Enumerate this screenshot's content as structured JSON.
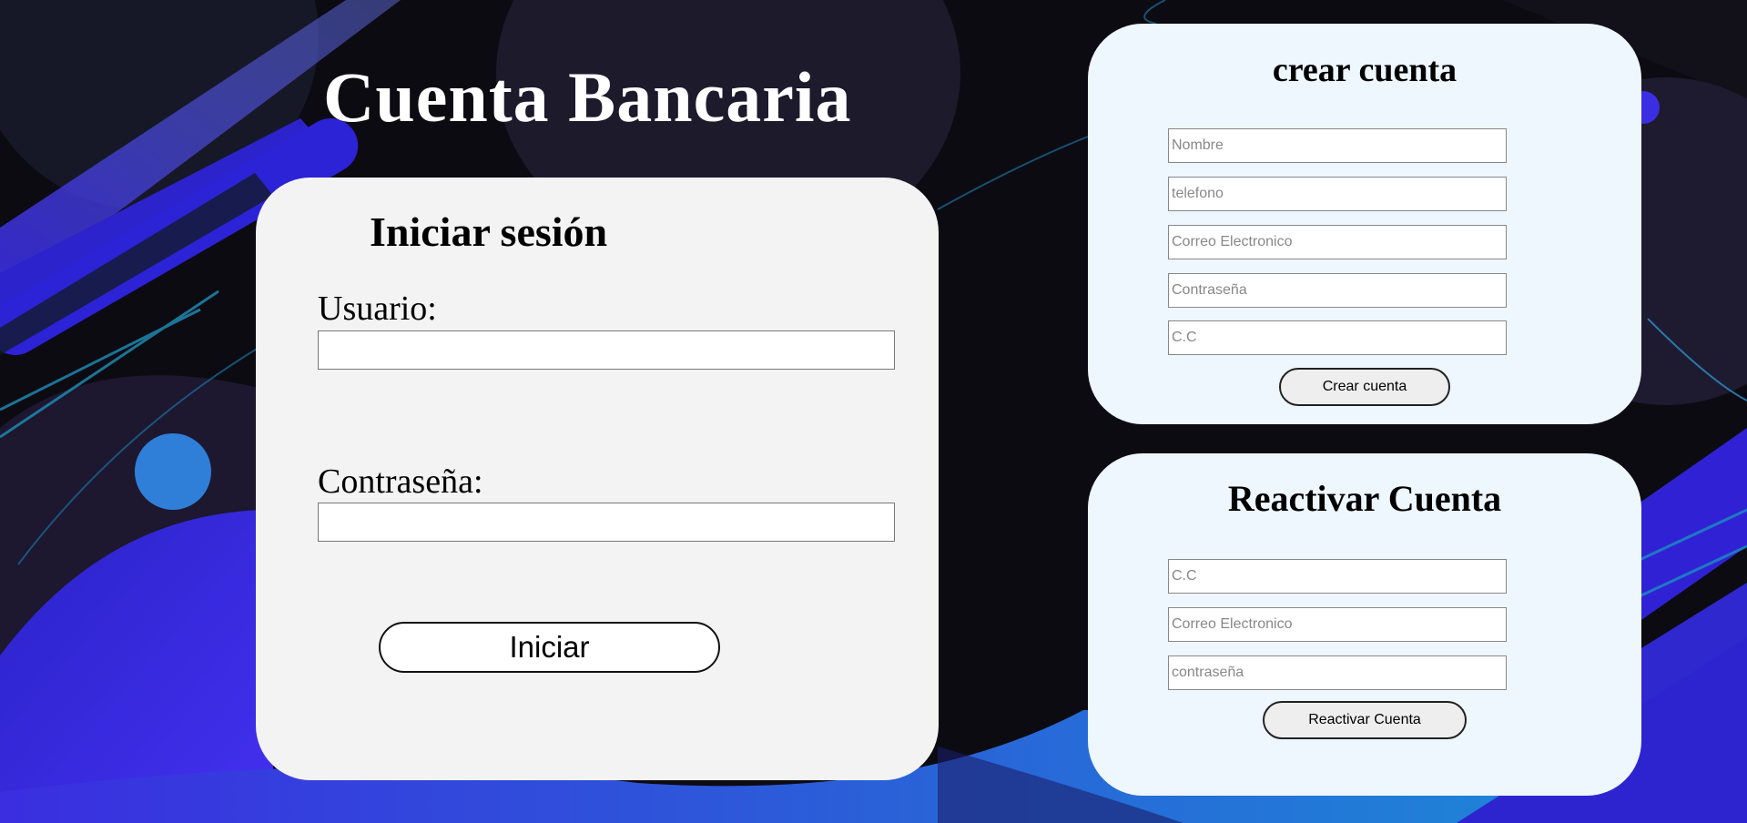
{
  "app": {
    "title": "Cuenta Bancaria"
  },
  "login": {
    "title": "Iniciar sesión",
    "user_label": "Usuario:",
    "user_value": "",
    "password_label": "Contraseña:",
    "password_value": "",
    "submit_label": "Iniciar"
  },
  "create": {
    "title": "crear cuenta",
    "fields": [
      {
        "placeholder": "Nombre"
      },
      {
        "placeholder": "telefono"
      },
      {
        "placeholder": "Correo Electronico"
      },
      {
        "placeholder": "Contraseña"
      },
      {
        "placeholder": "C.C"
      }
    ],
    "submit_label": "Crear cuenta"
  },
  "reactivate": {
    "title": "Reactivar Cuenta",
    "fields": [
      {
        "placeholder": "C.C"
      },
      {
        "placeholder": "Correo Electronico"
      },
      {
        "placeholder": "contraseña"
      }
    ],
    "submit_label": "Reactivar Cuenta"
  },
  "colors": {
    "background": "#0c0b12",
    "accent_blue": "#3322d8",
    "accent_cyan": "#1a9ad8",
    "login_card": "#f3f3f3",
    "side_card": "#eef6fe"
  }
}
